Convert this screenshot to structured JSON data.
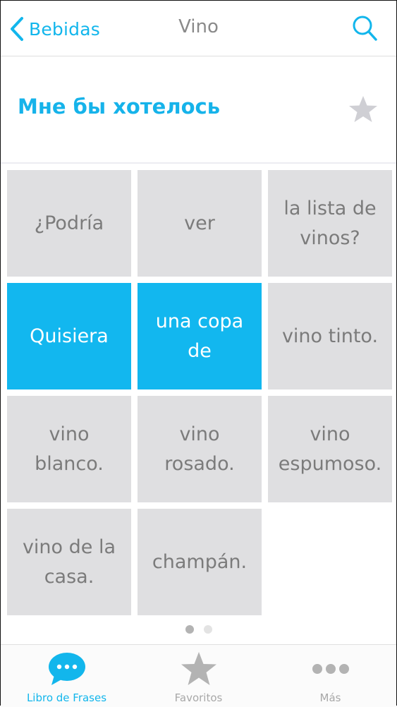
{
  "navbar": {
    "back_label": "Bebidas",
    "title": "Vino"
  },
  "phrase": {
    "text": "Мне бы хотелось"
  },
  "tiles": [
    {
      "text": "¿Podría",
      "selected": false
    },
    {
      "text": "ver",
      "selected": false
    },
    {
      "text": "la lista de vinos?",
      "selected": false
    },
    {
      "text": "Quisiera",
      "selected": true
    },
    {
      "text": "una copa de",
      "selected": true
    },
    {
      "text": "vino tinto.",
      "selected": false
    },
    {
      "text": "vino blanco.",
      "selected": false
    },
    {
      "text": "vino rosado.",
      "selected": false
    },
    {
      "text": "vino espumoso.",
      "selected": false
    },
    {
      "text": "vino de la casa.",
      "selected": false
    },
    {
      "text": "champán.",
      "selected": false
    }
  ],
  "pagination": {
    "current": 1,
    "total": 2
  },
  "tabbar": {
    "tabs": [
      {
        "label": "Libro de Frases",
        "icon": "speech-bubble-icon",
        "active": true
      },
      {
        "label": "Favoritos",
        "icon": "star-icon",
        "active": false
      },
      {
        "label": "Más",
        "icon": "more-dots-icon",
        "active": false
      }
    ]
  },
  "colors": {
    "accent": "#12b6ec",
    "tile": "#dfdfe1",
    "tile_text": "#7b7b7b",
    "selected_text": "#ffffff"
  }
}
